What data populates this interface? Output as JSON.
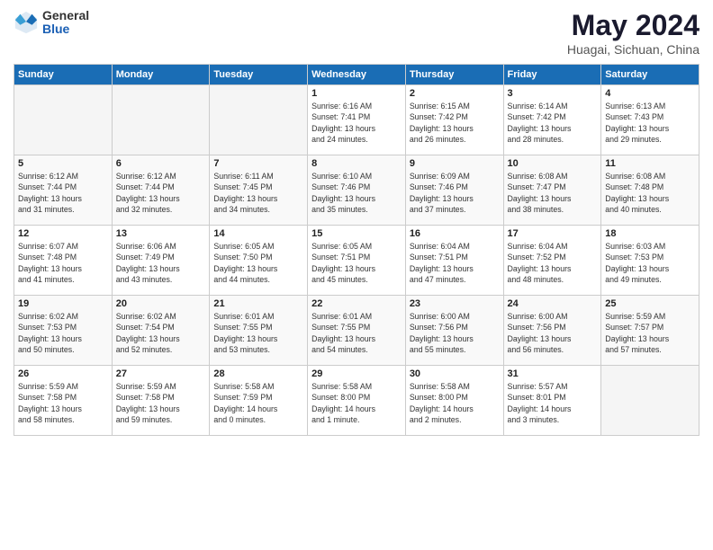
{
  "header": {
    "logo_general": "General",
    "logo_blue": "Blue",
    "month": "May 2024",
    "location": "Huagai, Sichuan, China"
  },
  "days_of_week": [
    "Sunday",
    "Monday",
    "Tuesday",
    "Wednesday",
    "Thursday",
    "Friday",
    "Saturday"
  ],
  "weeks": [
    [
      {
        "day": "",
        "info": ""
      },
      {
        "day": "",
        "info": ""
      },
      {
        "day": "",
        "info": ""
      },
      {
        "day": "1",
        "info": "Sunrise: 6:16 AM\nSunset: 7:41 PM\nDaylight: 13 hours\nand 24 minutes."
      },
      {
        "day": "2",
        "info": "Sunrise: 6:15 AM\nSunset: 7:42 PM\nDaylight: 13 hours\nand 26 minutes."
      },
      {
        "day": "3",
        "info": "Sunrise: 6:14 AM\nSunset: 7:42 PM\nDaylight: 13 hours\nand 28 minutes."
      },
      {
        "day": "4",
        "info": "Sunrise: 6:13 AM\nSunset: 7:43 PM\nDaylight: 13 hours\nand 29 minutes."
      }
    ],
    [
      {
        "day": "5",
        "info": "Sunrise: 6:12 AM\nSunset: 7:44 PM\nDaylight: 13 hours\nand 31 minutes."
      },
      {
        "day": "6",
        "info": "Sunrise: 6:12 AM\nSunset: 7:44 PM\nDaylight: 13 hours\nand 32 minutes."
      },
      {
        "day": "7",
        "info": "Sunrise: 6:11 AM\nSunset: 7:45 PM\nDaylight: 13 hours\nand 34 minutes."
      },
      {
        "day": "8",
        "info": "Sunrise: 6:10 AM\nSunset: 7:46 PM\nDaylight: 13 hours\nand 35 minutes."
      },
      {
        "day": "9",
        "info": "Sunrise: 6:09 AM\nSunset: 7:46 PM\nDaylight: 13 hours\nand 37 minutes."
      },
      {
        "day": "10",
        "info": "Sunrise: 6:08 AM\nSunset: 7:47 PM\nDaylight: 13 hours\nand 38 minutes."
      },
      {
        "day": "11",
        "info": "Sunrise: 6:08 AM\nSunset: 7:48 PM\nDaylight: 13 hours\nand 40 minutes."
      }
    ],
    [
      {
        "day": "12",
        "info": "Sunrise: 6:07 AM\nSunset: 7:48 PM\nDaylight: 13 hours\nand 41 minutes."
      },
      {
        "day": "13",
        "info": "Sunrise: 6:06 AM\nSunset: 7:49 PM\nDaylight: 13 hours\nand 43 minutes."
      },
      {
        "day": "14",
        "info": "Sunrise: 6:05 AM\nSunset: 7:50 PM\nDaylight: 13 hours\nand 44 minutes."
      },
      {
        "day": "15",
        "info": "Sunrise: 6:05 AM\nSunset: 7:51 PM\nDaylight: 13 hours\nand 45 minutes."
      },
      {
        "day": "16",
        "info": "Sunrise: 6:04 AM\nSunset: 7:51 PM\nDaylight: 13 hours\nand 47 minutes."
      },
      {
        "day": "17",
        "info": "Sunrise: 6:04 AM\nSunset: 7:52 PM\nDaylight: 13 hours\nand 48 minutes."
      },
      {
        "day": "18",
        "info": "Sunrise: 6:03 AM\nSunset: 7:53 PM\nDaylight: 13 hours\nand 49 minutes."
      }
    ],
    [
      {
        "day": "19",
        "info": "Sunrise: 6:02 AM\nSunset: 7:53 PM\nDaylight: 13 hours\nand 50 minutes."
      },
      {
        "day": "20",
        "info": "Sunrise: 6:02 AM\nSunset: 7:54 PM\nDaylight: 13 hours\nand 52 minutes."
      },
      {
        "day": "21",
        "info": "Sunrise: 6:01 AM\nSunset: 7:55 PM\nDaylight: 13 hours\nand 53 minutes."
      },
      {
        "day": "22",
        "info": "Sunrise: 6:01 AM\nSunset: 7:55 PM\nDaylight: 13 hours\nand 54 minutes."
      },
      {
        "day": "23",
        "info": "Sunrise: 6:00 AM\nSunset: 7:56 PM\nDaylight: 13 hours\nand 55 minutes."
      },
      {
        "day": "24",
        "info": "Sunrise: 6:00 AM\nSunset: 7:56 PM\nDaylight: 13 hours\nand 56 minutes."
      },
      {
        "day": "25",
        "info": "Sunrise: 5:59 AM\nSunset: 7:57 PM\nDaylight: 13 hours\nand 57 minutes."
      }
    ],
    [
      {
        "day": "26",
        "info": "Sunrise: 5:59 AM\nSunset: 7:58 PM\nDaylight: 13 hours\nand 58 minutes."
      },
      {
        "day": "27",
        "info": "Sunrise: 5:59 AM\nSunset: 7:58 PM\nDaylight: 13 hours\nand 59 minutes."
      },
      {
        "day": "28",
        "info": "Sunrise: 5:58 AM\nSunset: 7:59 PM\nDaylight: 14 hours\nand 0 minutes."
      },
      {
        "day": "29",
        "info": "Sunrise: 5:58 AM\nSunset: 8:00 PM\nDaylight: 14 hours\nand 1 minute."
      },
      {
        "day": "30",
        "info": "Sunrise: 5:58 AM\nSunset: 8:00 PM\nDaylight: 14 hours\nand 2 minutes."
      },
      {
        "day": "31",
        "info": "Sunrise: 5:57 AM\nSunset: 8:01 PM\nDaylight: 14 hours\nand 3 minutes."
      },
      {
        "day": "",
        "info": ""
      }
    ]
  ]
}
